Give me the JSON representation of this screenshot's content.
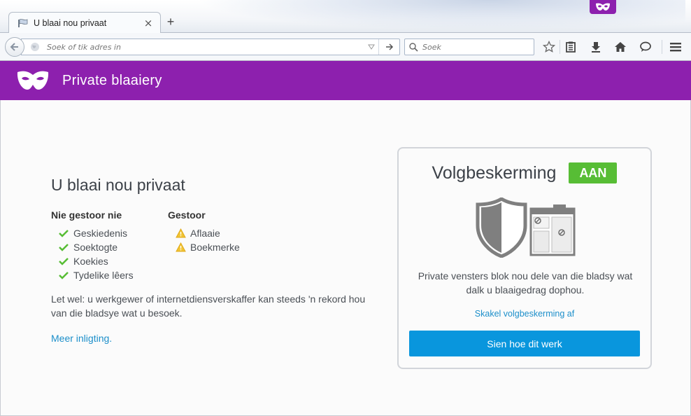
{
  "window": {
    "private_indicator_icon": "mask-icon",
    "private_color": "#8d20ae"
  },
  "tab": {
    "title": "U blaai nou privaat",
    "close_glyph": "×",
    "new_tab_glyph": "+"
  },
  "navbar": {
    "url_placeholder": "Soek of tik adres in",
    "search_placeholder": "Soek",
    "icons": [
      "back-icon",
      "globe-icon",
      "dropdown-icon",
      "go-arrow-icon",
      "search-icon",
      "bookmark-star-icon",
      "reading-list-icon",
      "download-icon",
      "home-icon",
      "chat-icon",
      "menu-icon"
    ]
  },
  "header": {
    "title": "Private blaaiery"
  },
  "main": {
    "heading": "U blaai nou privaat",
    "not_saved": {
      "title": "Nie gestoor nie",
      "items": [
        "Geskiedenis",
        "Soektogte",
        "Koekies",
        "Tydelike lêers"
      ]
    },
    "saved": {
      "title": "Gestoor",
      "items": [
        "Aflaaie",
        "Boekmerke"
      ]
    },
    "note": "Let wel: u werkgewer of internetdiensverskaffer kan steeds 'n rekord hou van die bladsye wat u besoek.",
    "more_link": "Meer inligting."
  },
  "tracking": {
    "label": "Volgbeskerming",
    "status": "AAN",
    "status_color": "#57bd35",
    "description": "Private vensters blok nou dele van die bladsy wat dalk u blaaigedrag dophou.",
    "toggle_link": "Skakel volgbeskerming af",
    "button": "Sien hoe dit werk",
    "button_color": "#0996dd"
  }
}
